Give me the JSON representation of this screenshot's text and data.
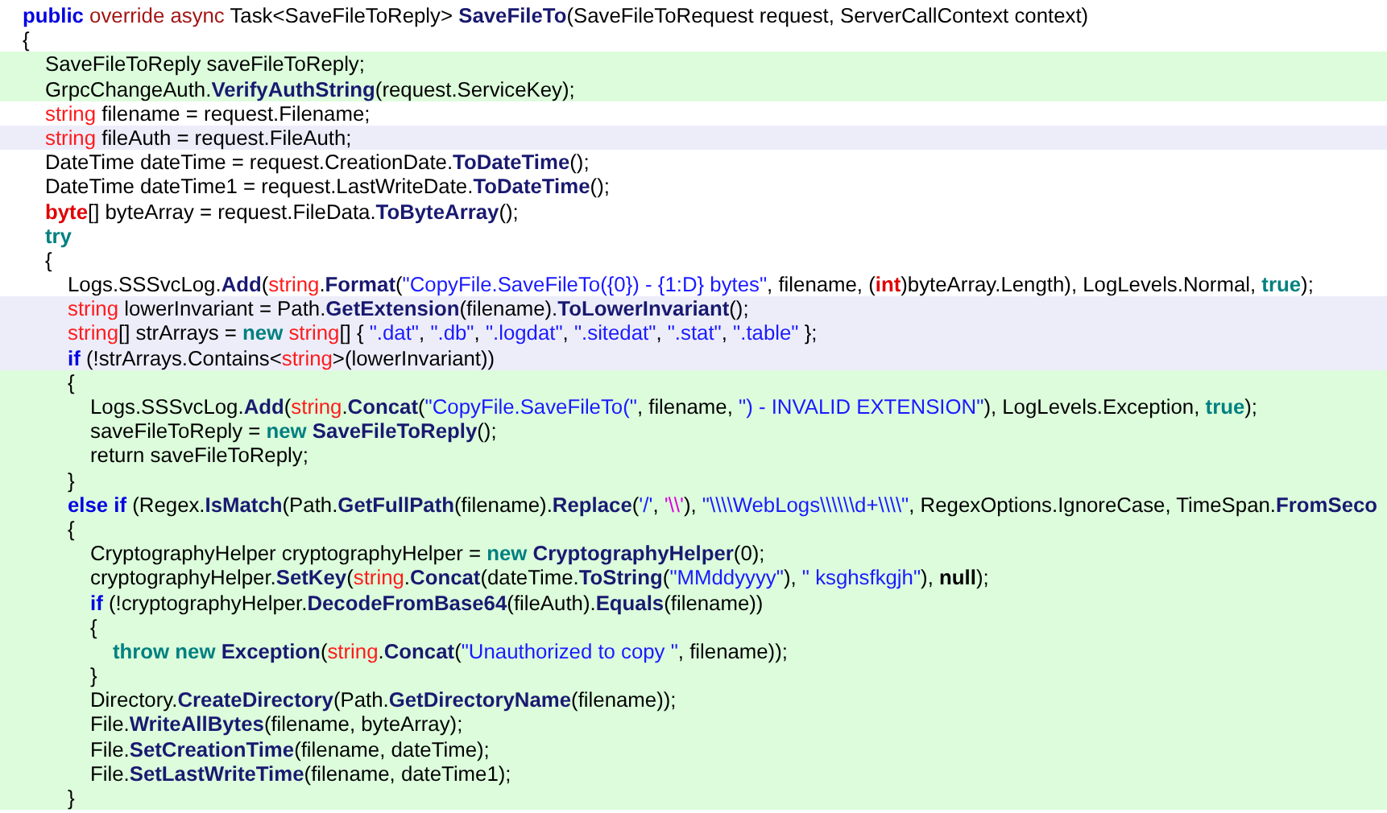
{
  "editor": {
    "lines": [
      {
        "added": false,
        "modified": false,
        "tokens": [
          {
            "text": "public",
            "kind": "keyword"
          },
          {
            "text": " override async",
            "kind": "modifier"
          },
          {
            "text": " Task<SaveFileToReply> ",
            "kind": "plain"
          },
          {
            "text": "SaveFileTo",
            "kind": "method"
          },
          {
            "text": "(SaveFileToRequest request, ServerCallContext context)",
            "kind": "plain"
          }
        ]
      },
      {
        "added": false,
        "modified": false,
        "tokens": [
          {
            "text": "{",
            "kind": "plain"
          }
        ],
        "children": [
          {
            "added": true,
            "modified": false,
            "tokens": [
              {
                "text": "SaveFileToReply saveFileToReply;",
                "kind": "plain"
              }
            ]
          },
          {
            "added": true,
            "modified": false,
            "tokens": [
              {
                "text": "GrpcChangeAuth.",
                "kind": "plain"
              },
              {
                "text": "VerifyAuthString",
                "kind": "method"
              },
              {
                "text": "(request.ServiceKey);",
                "kind": "plain"
              }
            ]
          },
          {
            "added": false,
            "modified": false,
            "tokens": [
              {
                "text": "string",
                "kind": "type"
              },
              {
                "text": " filename = request.Filename;",
                "kind": "plain"
              }
            ]
          },
          {
            "added": false,
            "modified": true,
            "tokens": [
              {
                "text": "string",
                "kind": "type"
              },
              {
                "text": " fileAuth = request.FileAuth;",
                "kind": "plain"
              }
            ]
          },
          {
            "added": false,
            "modified": false,
            "tokens": [
              {
                "text": "DateTime dateTime = request.CreationDate.",
                "kind": "plain"
              },
              {
                "text": "ToDateTime",
                "kind": "method"
              },
              {
                "text": "();",
                "kind": "plain"
              }
            ]
          },
          {
            "added": false,
            "modified": false,
            "tokens": [
              {
                "text": "DateTime dateTime1 = request.LastWriteDate.",
                "kind": "plain"
              },
              {
                "text": "ToDateTime",
                "kind": "method"
              },
              {
                "text": "();",
                "kind": "plain"
              }
            ]
          },
          {
            "added": false,
            "modified": false,
            "tokens": [
              {
                "text": "byte",
                "kind": "primitive"
              },
              {
                "text": "[] byteArray = request.FileData.",
                "kind": "plain"
              },
              {
                "text": "ToByteArray",
                "kind": "method"
              },
              {
                "text": "();",
                "kind": "plain"
              }
            ]
          },
          {
            "added": false,
            "modified": false,
            "tokens": [
              {
                "text": "try",
                "kind": "control"
              }
            ]
          },
          {
            "added": false,
            "modified": false,
            "tokens": [
              {
                "text": "{",
                "kind": "plain"
              }
            ],
            "children": [
              {
                "added": false,
                "modified": false,
                "tokens": [
                  {
                    "text": "Logs.SSSvcLog.",
                    "kind": "plain"
                  },
                  {
                    "text": "Add",
                    "kind": "method"
                  },
                  {
                    "text": "(",
                    "kind": "plain"
                  },
                  {
                    "text": "string",
                    "kind": "type"
                  },
                  {
                    "text": ".",
                    "kind": "plain"
                  },
                  {
                    "text": "Format",
                    "kind": "method"
                  },
                  {
                    "text": "(",
                    "kind": "plain"
                  },
                  {
                    "text": "\"CopyFile.SaveFileTo({0}) - {1:D} bytes\"",
                    "kind": "string"
                  },
                  {
                    "text": ", filename, (",
                    "kind": "plain"
                  },
                  {
                    "text": "int",
                    "kind": "primitive"
                  },
                  {
                    "text": ")byteArray.Length), LogLevels.Normal, ",
                    "kind": "plain"
                  },
                  {
                    "text": "true",
                    "kind": "control"
                  },
                  {
                    "text": ");",
                    "kind": "plain"
                  }
                ]
              },
              {
                "added": false,
                "modified": true,
                "tokens": [
                  {
                    "text": "string",
                    "kind": "type"
                  },
                  {
                    "text": " lowerInvariant = Path.",
                    "kind": "plain"
                  },
                  {
                    "text": "GetExtension",
                    "kind": "method"
                  },
                  {
                    "text": "(filename).",
                    "kind": "plain"
                  },
                  {
                    "text": "ToLowerInvariant",
                    "kind": "method"
                  },
                  {
                    "text": "();",
                    "kind": "plain"
                  }
                ]
              },
              {
                "added": false,
                "modified": true,
                "tokens": [
                  {
                    "text": "string",
                    "kind": "type"
                  },
                  {
                    "text": "[] strArrays = ",
                    "kind": "plain"
                  },
                  {
                    "text": "new ",
                    "kind": "control"
                  },
                  {
                    "text": "string",
                    "kind": "type"
                  },
                  {
                    "text": "[] { ",
                    "kind": "plain"
                  },
                  {
                    "text": "\".dat\"",
                    "kind": "string"
                  },
                  {
                    "text": ", ",
                    "kind": "plain"
                  },
                  {
                    "text": "\".db\"",
                    "kind": "string"
                  },
                  {
                    "text": ", ",
                    "kind": "plain"
                  },
                  {
                    "text": "\".logdat\"",
                    "kind": "string"
                  },
                  {
                    "text": ", ",
                    "kind": "plain"
                  },
                  {
                    "text": "\".sitedat\"",
                    "kind": "string"
                  },
                  {
                    "text": ", ",
                    "kind": "plain"
                  },
                  {
                    "text": "\".stat\"",
                    "kind": "string"
                  },
                  {
                    "text": ", ",
                    "kind": "plain"
                  },
                  {
                    "text": "\".table\"",
                    "kind": "string"
                  },
                  {
                    "text": " };",
                    "kind": "plain"
                  }
                ]
              },
              {
                "added": false,
                "modified": true,
                "tokens": [
                  {
                    "text": "if",
                    "kind": "keyword"
                  },
                  {
                    "text": " (!strArrays.Contains<",
                    "kind": "plain"
                  },
                  {
                    "text": "string",
                    "kind": "type"
                  },
                  {
                    "text": ">(lowerInvariant))",
                    "kind": "plain"
                  }
                ]
              },
              {
                "added": true,
                "modified": false,
                "tokens": [
                  {
                    "text": "{",
                    "kind": "plain"
                  }
                ],
                "children": [
                  {
                    "added": true,
                    "modified": false,
                    "tokens": [
                      {
                        "text": "Logs.SSSvcLog.",
                        "kind": "plain"
                      },
                      {
                        "text": "Add",
                        "kind": "method"
                      },
                      {
                        "text": "(",
                        "kind": "plain"
                      },
                      {
                        "text": "string",
                        "kind": "type"
                      },
                      {
                        "text": ".",
                        "kind": "plain"
                      },
                      {
                        "text": "Concat",
                        "kind": "method"
                      },
                      {
                        "text": "(",
                        "kind": "plain"
                      },
                      {
                        "text": "\"CopyFile.SaveFileTo(\"",
                        "kind": "string"
                      },
                      {
                        "text": ", filename, ",
                        "kind": "plain"
                      },
                      {
                        "text": "\") - INVALID EXTENSION\"",
                        "kind": "string"
                      },
                      {
                        "text": "), LogLevels.Exception, ",
                        "kind": "plain"
                      },
                      {
                        "text": "true",
                        "kind": "control"
                      },
                      {
                        "text": ");",
                        "kind": "plain"
                      }
                    ]
                  },
                  {
                    "added": true,
                    "modified": false,
                    "tokens": [
                      {
                        "text": "saveFileToReply = ",
                        "kind": "plain"
                      },
                      {
                        "text": "new ",
                        "kind": "control"
                      },
                      {
                        "text": "SaveFileToReply",
                        "kind": "method"
                      },
                      {
                        "text": "();",
                        "kind": "plain"
                      }
                    ]
                  },
                  {
                    "added": true,
                    "modified": false,
                    "tokens": [
                      {
                        "text": "return saveFileToReply;",
                        "kind": "plain"
                      }
                    ]
                  }
                ]
              },
              {
                "added": true,
                "modified": false,
                "tokens": [
                  {
                    "text": "}",
                    "kind": "plain"
                  }
                ]
              },
              {
                "added": true,
                "modified": false,
                "tokens": [
                  {
                    "text": "else if",
                    "kind": "keyword"
                  },
                  {
                    "text": " (Regex.",
                    "kind": "plain"
                  },
                  {
                    "text": "IsMatch",
                    "kind": "method"
                  },
                  {
                    "text": "(Path.",
                    "kind": "plain"
                  },
                  {
                    "text": "GetFullPath",
                    "kind": "method"
                  },
                  {
                    "text": "(filename).",
                    "kind": "plain"
                  },
                  {
                    "text": "Replace",
                    "kind": "method"
                  },
                  {
                    "text": "(",
                    "kind": "plain"
                  },
                  {
                    "text": "'/'",
                    "kind": "string"
                  },
                  {
                    "text": ", ",
                    "kind": "plain"
                  },
                  {
                    "text": "'\\\\'",
                    "kind": "charlit"
                  },
                  {
                    "text": "), ",
                    "kind": "plain"
                  },
                  {
                    "text": "\"\\\\\\\\WebLogs\\\\\\\\\\\\d+\\\\\\\\\"",
                    "kind": "string"
                  },
                  {
                    "text": ", RegexOptions.IgnoreCase, TimeSpan.",
                    "kind": "plain"
                  },
                  {
                    "text": "FromSeco",
                    "kind": "method"
                  }
                ]
              },
              {
                "added": true,
                "modified": false,
                "tokens": [
                  {
                    "text": "{",
                    "kind": "plain"
                  }
                ],
                "children": [
                  {
                    "added": true,
                    "modified": false,
                    "tokens": [
                      {
                        "text": "CryptographyHelper cryptographyHelper = ",
                        "kind": "plain"
                      },
                      {
                        "text": "new ",
                        "kind": "control"
                      },
                      {
                        "text": "CryptographyHelper",
                        "kind": "method"
                      },
                      {
                        "text": "(0);",
                        "kind": "plain"
                      }
                    ]
                  },
                  {
                    "added": true,
                    "modified": false,
                    "tokens": [
                      {
                        "text": "cryptographyHelper.",
                        "kind": "plain"
                      },
                      {
                        "text": "SetKey",
                        "kind": "method"
                      },
                      {
                        "text": "(",
                        "kind": "plain"
                      },
                      {
                        "text": "string",
                        "kind": "type"
                      },
                      {
                        "text": ".",
                        "kind": "plain"
                      },
                      {
                        "text": "Concat",
                        "kind": "method"
                      },
                      {
                        "text": "(dateTime.",
                        "kind": "plain"
                      },
                      {
                        "text": "ToString",
                        "kind": "method"
                      },
                      {
                        "text": "(",
                        "kind": "plain"
                      },
                      {
                        "text": "\"MMddyyyy\"",
                        "kind": "string"
                      },
                      {
                        "text": "), ",
                        "kind": "plain"
                      },
                      {
                        "text": "\" ksghsfkgjh\"",
                        "kind": "string"
                      },
                      {
                        "text": "), ",
                        "kind": "plain"
                      },
                      {
                        "text": "null",
                        "kind": "literal"
                      },
                      {
                        "text": ");",
                        "kind": "plain"
                      }
                    ]
                  },
                  {
                    "added": true,
                    "modified": false,
                    "tokens": [
                      {
                        "text": "if",
                        "kind": "keyword"
                      },
                      {
                        "text": " (!cryptographyHelper.",
                        "kind": "plain"
                      },
                      {
                        "text": "DecodeFromBase64",
                        "kind": "method"
                      },
                      {
                        "text": "(fileAuth).",
                        "kind": "plain"
                      },
                      {
                        "text": "Equals",
                        "kind": "method"
                      },
                      {
                        "text": "(filename))",
                        "kind": "plain"
                      }
                    ]
                  },
                  {
                    "added": true,
                    "modified": false,
                    "tokens": [
                      {
                        "text": "{",
                        "kind": "plain"
                      }
                    ],
                    "children": [
                      {
                        "added": true,
                        "modified": false,
                        "tokens": [
                          {
                            "text": "throw new ",
                            "kind": "control"
                          },
                          {
                            "text": "Exception",
                            "kind": "method"
                          },
                          {
                            "text": "(",
                            "kind": "plain"
                          },
                          {
                            "text": "string",
                            "kind": "type"
                          },
                          {
                            "text": ".",
                            "kind": "plain"
                          },
                          {
                            "text": "Concat",
                            "kind": "method"
                          },
                          {
                            "text": "(",
                            "kind": "plain"
                          },
                          {
                            "text": "\"Unauthorized to copy \"",
                            "kind": "string"
                          },
                          {
                            "text": ", filename));",
                            "kind": "plain"
                          }
                        ]
                      }
                    ]
                  },
                  {
                    "added": true,
                    "modified": false,
                    "tokens": [
                      {
                        "text": "}",
                        "kind": "plain"
                      }
                    ]
                  },
                  {
                    "added": true,
                    "modified": false,
                    "tokens": [
                      {
                        "text": "Directory.",
                        "kind": "plain"
                      },
                      {
                        "text": "CreateDirectory",
                        "kind": "method"
                      },
                      {
                        "text": "(Path.",
                        "kind": "plain"
                      },
                      {
                        "text": "GetDirectoryName",
                        "kind": "method"
                      },
                      {
                        "text": "(filename));",
                        "kind": "plain"
                      }
                    ]
                  },
                  {
                    "added": true,
                    "modified": false,
                    "tokens": [
                      {
                        "text": "File.",
                        "kind": "plain"
                      },
                      {
                        "text": "WriteAllBytes",
                        "kind": "method"
                      },
                      {
                        "text": "(filename, byteArray);",
                        "kind": "plain"
                      }
                    ]
                  },
                  {
                    "added": true,
                    "modified": false,
                    "tokens": [
                      {
                        "text": "File.",
                        "kind": "plain"
                      },
                      {
                        "text": "SetCreationTime",
                        "kind": "method"
                      },
                      {
                        "text": "(filename, dateTime);",
                        "kind": "plain"
                      }
                    ]
                  },
                  {
                    "added": true,
                    "modified": false,
                    "tokens": [
                      {
                        "text": "File.",
                        "kind": "plain"
                      },
                      {
                        "text": "SetLastWriteTime",
                        "kind": "method"
                      },
                      {
                        "text": "(filename, dateTime1);",
                        "kind": "plain"
                      }
                    ]
                  }
                ]
              },
              {
                "added": true,
                "modified": false,
                "tokens": [
                  {
                    "text": "}",
                    "kind": "plain"
                  }
                ]
              }
            ]
          }
        ]
      }
    ]
  }
}
